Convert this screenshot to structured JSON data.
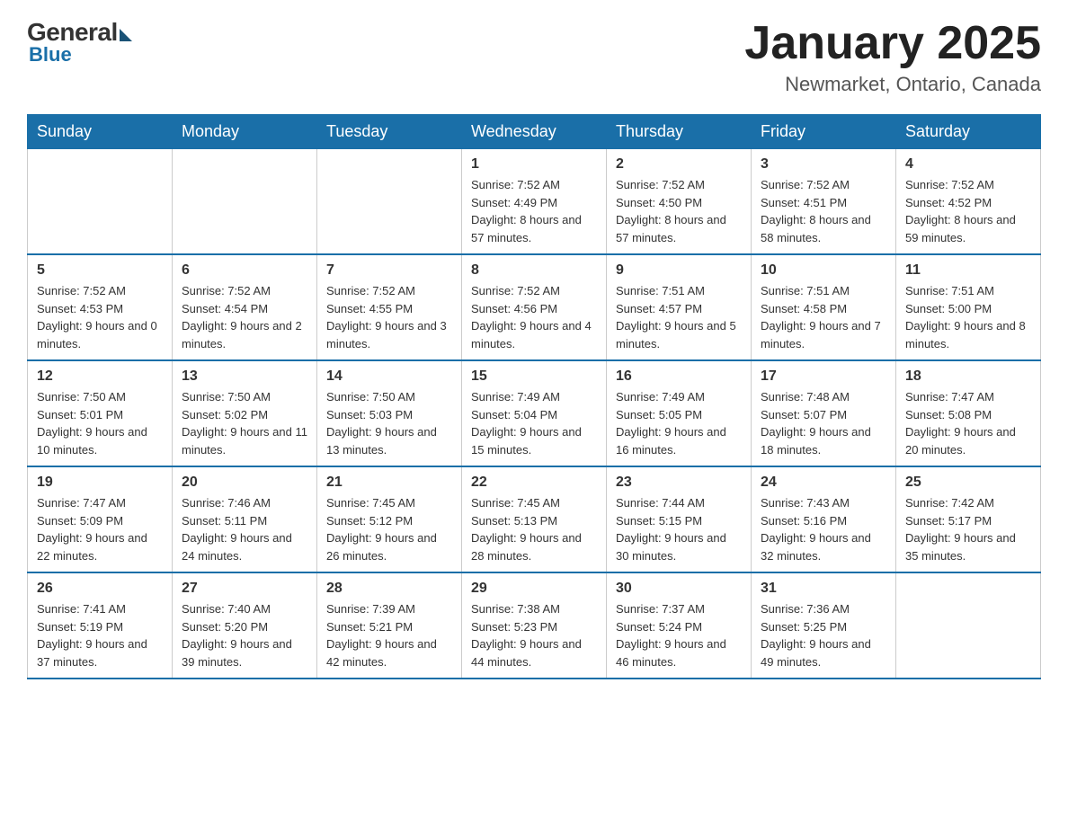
{
  "header": {
    "logo": {
      "general": "General",
      "blue": "Blue"
    },
    "title": "January 2025",
    "location": "Newmarket, Ontario, Canada"
  },
  "days_of_week": [
    "Sunday",
    "Monday",
    "Tuesday",
    "Wednesday",
    "Thursday",
    "Friday",
    "Saturday"
  ],
  "weeks": [
    [
      {
        "day": "",
        "info": ""
      },
      {
        "day": "",
        "info": ""
      },
      {
        "day": "",
        "info": ""
      },
      {
        "day": "1",
        "info": "Sunrise: 7:52 AM\nSunset: 4:49 PM\nDaylight: 8 hours and 57 minutes."
      },
      {
        "day": "2",
        "info": "Sunrise: 7:52 AM\nSunset: 4:50 PM\nDaylight: 8 hours and 57 minutes."
      },
      {
        "day": "3",
        "info": "Sunrise: 7:52 AM\nSunset: 4:51 PM\nDaylight: 8 hours and 58 minutes."
      },
      {
        "day": "4",
        "info": "Sunrise: 7:52 AM\nSunset: 4:52 PM\nDaylight: 8 hours and 59 minutes."
      }
    ],
    [
      {
        "day": "5",
        "info": "Sunrise: 7:52 AM\nSunset: 4:53 PM\nDaylight: 9 hours and 0 minutes."
      },
      {
        "day": "6",
        "info": "Sunrise: 7:52 AM\nSunset: 4:54 PM\nDaylight: 9 hours and 2 minutes."
      },
      {
        "day": "7",
        "info": "Sunrise: 7:52 AM\nSunset: 4:55 PM\nDaylight: 9 hours and 3 minutes."
      },
      {
        "day": "8",
        "info": "Sunrise: 7:52 AM\nSunset: 4:56 PM\nDaylight: 9 hours and 4 minutes."
      },
      {
        "day": "9",
        "info": "Sunrise: 7:51 AM\nSunset: 4:57 PM\nDaylight: 9 hours and 5 minutes."
      },
      {
        "day": "10",
        "info": "Sunrise: 7:51 AM\nSunset: 4:58 PM\nDaylight: 9 hours and 7 minutes."
      },
      {
        "day": "11",
        "info": "Sunrise: 7:51 AM\nSunset: 5:00 PM\nDaylight: 9 hours and 8 minutes."
      }
    ],
    [
      {
        "day": "12",
        "info": "Sunrise: 7:50 AM\nSunset: 5:01 PM\nDaylight: 9 hours and 10 minutes."
      },
      {
        "day": "13",
        "info": "Sunrise: 7:50 AM\nSunset: 5:02 PM\nDaylight: 9 hours and 11 minutes."
      },
      {
        "day": "14",
        "info": "Sunrise: 7:50 AM\nSunset: 5:03 PM\nDaylight: 9 hours and 13 minutes."
      },
      {
        "day": "15",
        "info": "Sunrise: 7:49 AM\nSunset: 5:04 PM\nDaylight: 9 hours and 15 minutes."
      },
      {
        "day": "16",
        "info": "Sunrise: 7:49 AM\nSunset: 5:05 PM\nDaylight: 9 hours and 16 minutes."
      },
      {
        "day": "17",
        "info": "Sunrise: 7:48 AM\nSunset: 5:07 PM\nDaylight: 9 hours and 18 minutes."
      },
      {
        "day": "18",
        "info": "Sunrise: 7:47 AM\nSunset: 5:08 PM\nDaylight: 9 hours and 20 minutes."
      }
    ],
    [
      {
        "day": "19",
        "info": "Sunrise: 7:47 AM\nSunset: 5:09 PM\nDaylight: 9 hours and 22 minutes."
      },
      {
        "day": "20",
        "info": "Sunrise: 7:46 AM\nSunset: 5:11 PM\nDaylight: 9 hours and 24 minutes."
      },
      {
        "day": "21",
        "info": "Sunrise: 7:45 AM\nSunset: 5:12 PM\nDaylight: 9 hours and 26 minutes."
      },
      {
        "day": "22",
        "info": "Sunrise: 7:45 AM\nSunset: 5:13 PM\nDaylight: 9 hours and 28 minutes."
      },
      {
        "day": "23",
        "info": "Sunrise: 7:44 AM\nSunset: 5:15 PM\nDaylight: 9 hours and 30 minutes."
      },
      {
        "day": "24",
        "info": "Sunrise: 7:43 AM\nSunset: 5:16 PM\nDaylight: 9 hours and 32 minutes."
      },
      {
        "day": "25",
        "info": "Sunrise: 7:42 AM\nSunset: 5:17 PM\nDaylight: 9 hours and 35 minutes."
      }
    ],
    [
      {
        "day": "26",
        "info": "Sunrise: 7:41 AM\nSunset: 5:19 PM\nDaylight: 9 hours and 37 minutes."
      },
      {
        "day": "27",
        "info": "Sunrise: 7:40 AM\nSunset: 5:20 PM\nDaylight: 9 hours and 39 minutes."
      },
      {
        "day": "28",
        "info": "Sunrise: 7:39 AM\nSunset: 5:21 PM\nDaylight: 9 hours and 42 minutes."
      },
      {
        "day": "29",
        "info": "Sunrise: 7:38 AM\nSunset: 5:23 PM\nDaylight: 9 hours and 44 minutes."
      },
      {
        "day": "30",
        "info": "Sunrise: 7:37 AM\nSunset: 5:24 PM\nDaylight: 9 hours and 46 minutes."
      },
      {
        "day": "31",
        "info": "Sunrise: 7:36 AM\nSunset: 5:25 PM\nDaylight: 9 hours and 49 minutes."
      },
      {
        "day": "",
        "info": ""
      }
    ]
  ]
}
